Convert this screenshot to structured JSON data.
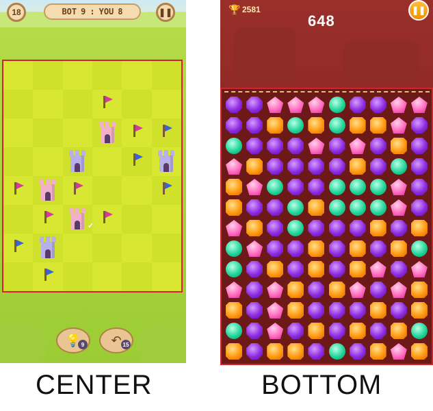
{
  "left_game": {
    "level": "18",
    "score_bot_label": "BOT",
    "score_bot_value": "9",
    "score_sep": ":",
    "score_you_label": "YOU",
    "score_you_value": "8",
    "pause_icon": "pause-icon",
    "hint_badge": "9",
    "undo_badge": "15",
    "colors": {
      "board_light": "#d8e832",
      "board_dark": "#cfe12a",
      "flag_pink": "#d23c9a",
      "flag_blue": "#3a63d6",
      "tower_pink": "#f2b0c8",
      "tower_purple": "#b8b0e8"
    },
    "grid": {
      "columns": 6,
      "rows": 8,
      "cells": [
        {
          "r": 1,
          "c": 3,
          "type": "flag",
          "color": "pink"
        },
        {
          "r": 2,
          "c": 3,
          "type": "tower",
          "color": "pink"
        },
        {
          "r": 2,
          "c": 4,
          "type": "flag",
          "color": "pink"
        },
        {
          "r": 2,
          "c": 5,
          "type": "flag",
          "color": "blue"
        },
        {
          "r": 3,
          "c": 2,
          "type": "tower",
          "color": "purple"
        },
        {
          "r": 3,
          "c": 4,
          "type": "flag",
          "color": "blue"
        },
        {
          "r": 3,
          "c": 5,
          "type": "tower",
          "color": "purple"
        },
        {
          "r": 4,
          "c": 0,
          "type": "flag",
          "color": "pink"
        },
        {
          "r": 4,
          "c": 1,
          "type": "tower",
          "color": "pink"
        },
        {
          "r": 4,
          "c": 2,
          "type": "flag",
          "color": "pink"
        },
        {
          "r": 4,
          "c": 5,
          "type": "flag",
          "color": "blue"
        },
        {
          "r": 5,
          "c": 1,
          "type": "flag",
          "color": "pink"
        },
        {
          "r": 5,
          "c": 2,
          "type": "tower",
          "color": "pink",
          "check": true
        },
        {
          "r": 5,
          "c": 3,
          "type": "flag",
          "color": "pink"
        },
        {
          "r": 6,
          "c": 0,
          "type": "flag",
          "color": "blue"
        },
        {
          "r": 6,
          "c": 1,
          "type": "tower",
          "color": "purple"
        },
        {
          "r": 7,
          "c": 1,
          "type": "flag",
          "color": "blue"
        }
      ]
    }
  },
  "right_game": {
    "trophy_score": "2581",
    "score": "648",
    "colors": {
      "gem_purple": "#8d2be0",
      "gem_pink": "#ff6bbf",
      "gem_orange": "#ff9a12",
      "gem_green": "#21d69a"
    },
    "board": [
      "PPKKKGPPKK",
      "PPOGOGOOKP",
      "GPPPKPKPOP",
      "KOPPPPOPGP",
      "OKGPPGGGKP",
      "OPPGOGGGKP",
      "KOPGPPPOPO",
      "GKPPOPOPOG",
      "GPOPOPOKPK",
      "KPKOPOKPKO",
      "OPKOPPPOPO",
      "GPKPOPOPOG",
      "OPOOPGPOKO"
    ]
  },
  "captions": {
    "left": "CENTER",
    "right": "BOTTOM"
  }
}
